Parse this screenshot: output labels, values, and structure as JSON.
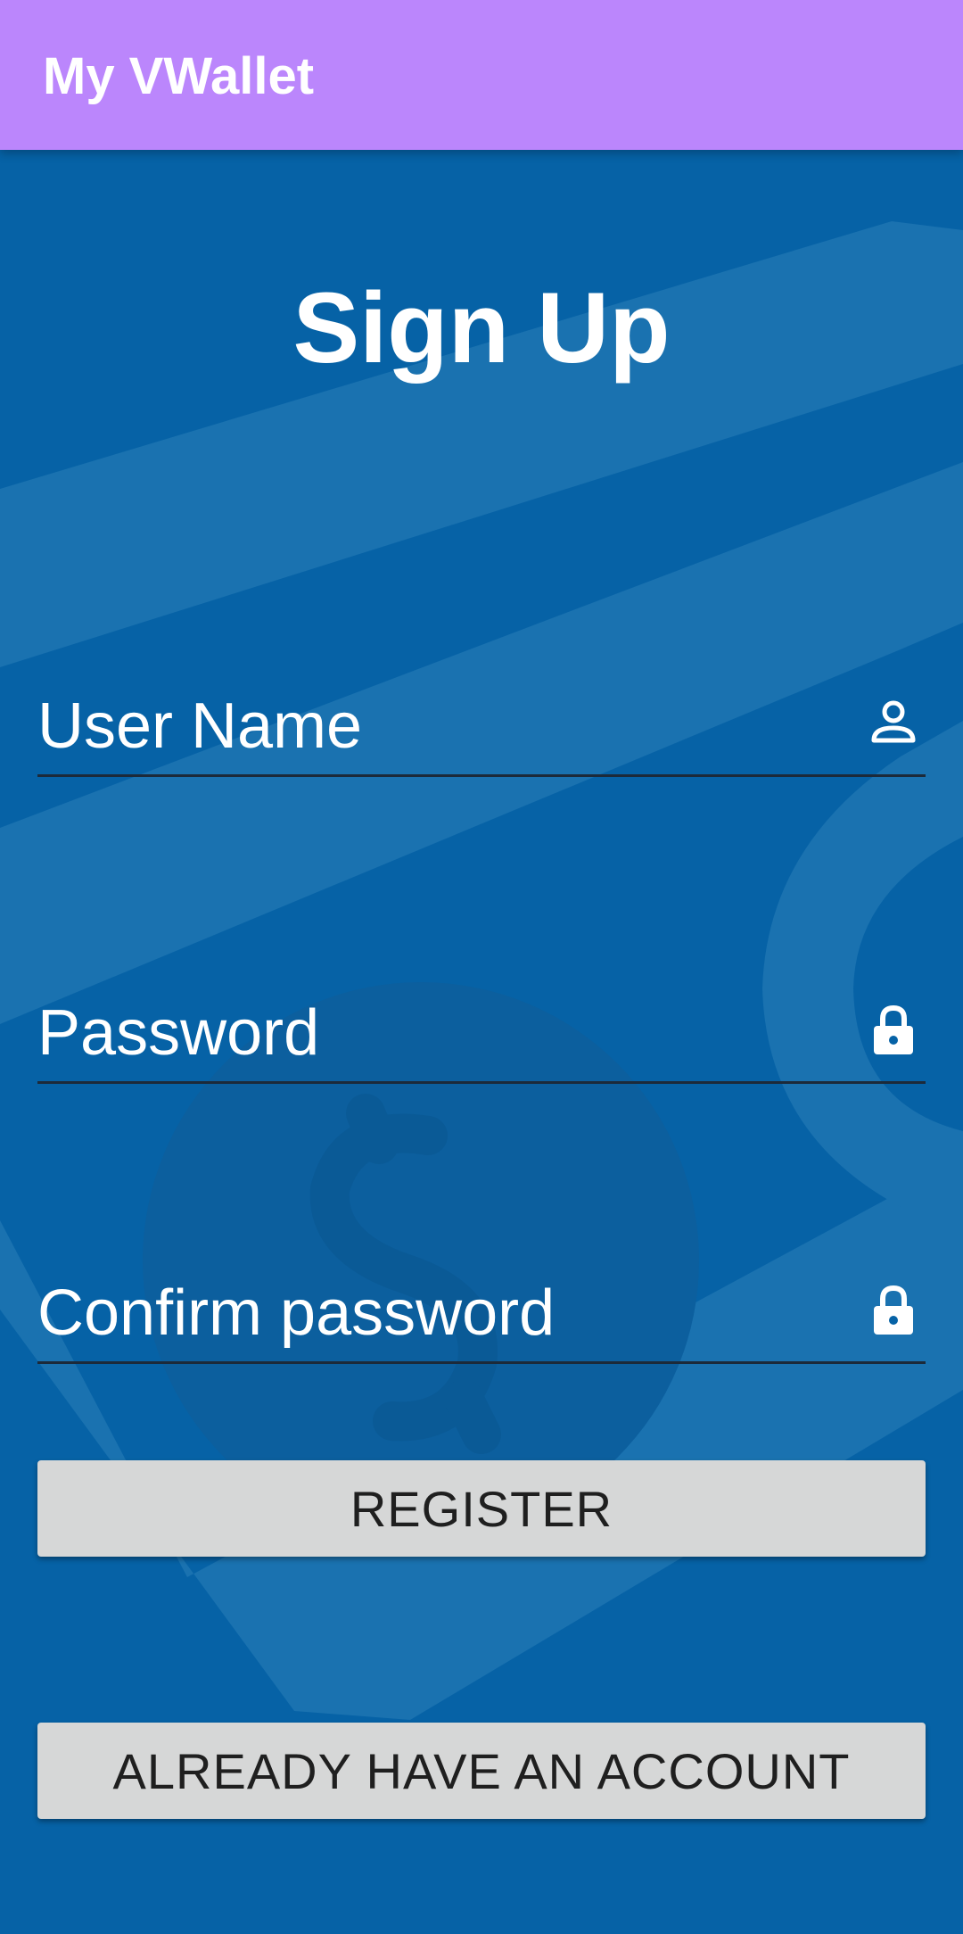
{
  "app_bar": {
    "title": "My VWallet",
    "color": "#bb86fc"
  },
  "screen": {
    "background_color": "#0662a6",
    "title": "Sign Up"
  },
  "form": {
    "username": {
      "placeholder": "User Name",
      "icon": "person-icon"
    },
    "password": {
      "placeholder": "Password",
      "icon": "lock-icon"
    },
    "confirm_password": {
      "placeholder": "Confirm password",
      "icon": "lock-icon"
    }
  },
  "buttons": {
    "register": "REGISTER",
    "login": "ALREADY HAVE AN ACCOUNT"
  }
}
